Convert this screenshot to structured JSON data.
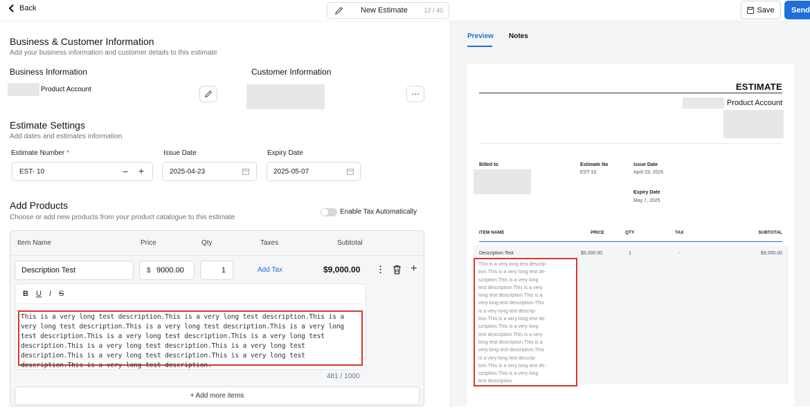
{
  "header": {
    "back_label": "Back",
    "doc_title": "New Estimate",
    "title_count": "12 / 40",
    "save_label": "Save",
    "send_label": "Send"
  },
  "business_customer": {
    "title": "Business & Customer Information",
    "subtitle": "Add your business information and customer details to this estimate",
    "business_label": "Business Information",
    "business_name": "Product Account",
    "customer_label": "Customer Information"
  },
  "settings": {
    "title": "Estimate Settings",
    "subtitle": "Add dates and estimates information",
    "number_label": "Estimate Number",
    "required_mark": "*",
    "number_value": "EST- 10",
    "issue_label": "Issue Date",
    "issue_value": "2025-04-23",
    "expiry_label": "Expiry Date",
    "expiry_value": "2025-05-07"
  },
  "products": {
    "title": "Add Products",
    "subtitle": "Choose or add new products from your product catalogue to this estimate",
    "tax_toggle_label": "Enable Tax Automatically",
    "columns": [
      "Item Name",
      "Price",
      "Qty",
      "Taxes",
      "Subtotal"
    ],
    "item_name": "Description Test",
    "currency": "$",
    "price": "9000.00",
    "qty": "1",
    "add_tax": "Add Tax",
    "subtotal": "$9,000.00",
    "description": "This is a very long test description.This is a very long test description.This is a very long test description.This is a very long test description.This is a very long test description.This is a very long test description.This is a very long test description.This is a very long test description.This is a very long test description.This is a very long test description.This is a very long test description.This is a very long test description.",
    "char_count": "481 / 1000",
    "add_more": "+ Add more items"
  },
  "preview": {
    "tab_preview": "Preview",
    "tab_notes": "Notes",
    "heading": "ESTIMATE",
    "business_name": "Product Account",
    "billed_to": "Billed to",
    "estimate_no_label": "Estimate No",
    "estimate_no": "EST-10",
    "issue_label": "Issue Date",
    "issue_value": "April 23, 2025",
    "expiry_label": "Expiry Date",
    "expiry_value": "May 7, 2025",
    "columns": [
      "ITEM NAME",
      "PRICE",
      "QTY",
      "TAX",
      "SUBTOTAL"
    ],
    "item_name": "Description Test",
    "price": "$9,000.00",
    "qty": "1",
    "tax": "-",
    "subtotal": "$9,000.00",
    "description_lines": [
      "This is a very long test descrip-",
      "tion.This is a very long test de-",
      "scription.This is a very long",
      "test description.This is a very",
      "long test description.This is a",
      "very long test description.This",
      "is a very long test descrip-",
      "tion.This is a very long test de-",
      "scription.This is a very long",
      "test description.This is a very",
      "long test description.This is a",
      "very long test description.This",
      "is a very long test descrip-",
      "tion.This is a very long test de-",
      "scription.This is a very long",
      "test description."
    ]
  },
  "colors": {
    "accent": "#1e6fd9",
    "highlight": "#d9362b"
  }
}
